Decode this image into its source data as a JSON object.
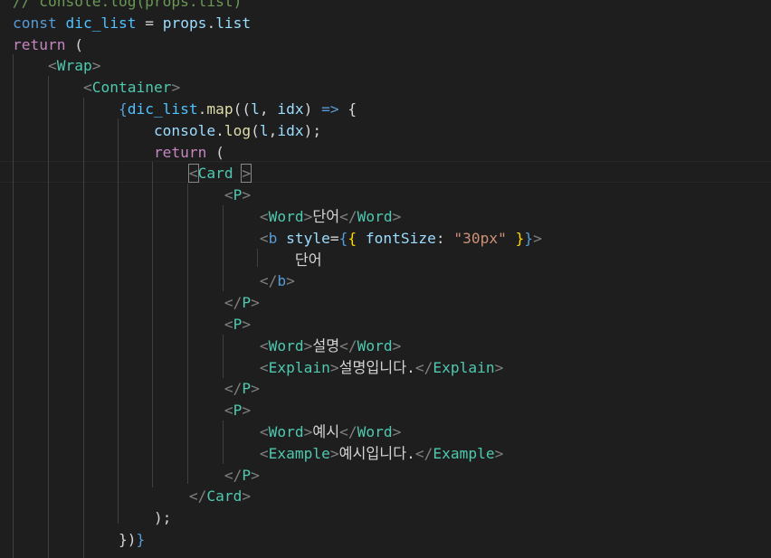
{
  "editor": {
    "lines": [
      [
        {
          "t": "// console.log(props.list)",
          "c": "comment"
        }
      ],
      [
        {
          "t": "const ",
          "c": "kw"
        },
        {
          "t": "dic_list",
          "c": "const"
        },
        {
          "t": " = ",
          "c": "op"
        },
        {
          "t": "props",
          "c": "var"
        },
        {
          "t": ".",
          "c": "op"
        },
        {
          "t": "list",
          "c": "var"
        }
      ],
      [
        {
          "t": "return",
          "c": "ctrl"
        },
        {
          "t": " (",
          "c": "op"
        }
      ],
      [
        {
          "t": "    ",
          "c": "text"
        },
        {
          "t": "<",
          "c": "punc"
        },
        {
          "t": "Wrap",
          "c": "tag"
        },
        {
          "t": ">",
          "c": "punc"
        }
      ],
      [
        {
          "t": "        ",
          "c": "text"
        },
        {
          "t": "<",
          "c": "punc"
        },
        {
          "t": "Container",
          "c": "tag"
        },
        {
          "t": ">",
          "c": "punc"
        }
      ],
      [
        {
          "t": "            ",
          "c": "text"
        },
        {
          "t": "{",
          "c": "brace"
        },
        {
          "t": "dic_list",
          "c": "const"
        },
        {
          "t": ".",
          "c": "op"
        },
        {
          "t": "map",
          "c": "fn"
        },
        {
          "t": "((",
          "c": "op"
        },
        {
          "t": "l",
          "c": "var"
        },
        {
          "t": ", ",
          "c": "op"
        },
        {
          "t": "idx",
          "c": "var"
        },
        {
          "t": ") ",
          "c": "op"
        },
        {
          "t": "=>",
          "c": "kw"
        },
        {
          "t": " {",
          "c": "op"
        }
      ],
      [
        {
          "t": "                ",
          "c": "text"
        },
        {
          "t": "console",
          "c": "var"
        },
        {
          "t": ".",
          "c": "op"
        },
        {
          "t": "log",
          "c": "fn"
        },
        {
          "t": "(",
          "c": "op"
        },
        {
          "t": "l",
          "c": "var"
        },
        {
          "t": ",",
          "c": "op"
        },
        {
          "t": "idx",
          "c": "var"
        },
        {
          "t": ");",
          "c": "op"
        }
      ],
      [
        {
          "t": "                ",
          "c": "text"
        },
        {
          "t": "return",
          "c": "ctrl"
        },
        {
          "t": " (",
          "c": "op"
        }
      ],
      [
        {
          "t": "                    ",
          "c": "text"
        },
        {
          "t": "<",
          "c": "punc",
          "box": true
        },
        {
          "t": "Card",
          "c": "tag"
        },
        {
          "t": " ",
          "c": "text"
        },
        {
          "t": ">",
          "c": "punc",
          "box": true
        }
      ],
      [
        {
          "t": "                        ",
          "c": "text"
        },
        {
          "t": "<",
          "c": "punc"
        },
        {
          "t": "P",
          "c": "tag"
        },
        {
          "t": ">",
          "c": "punc"
        }
      ],
      [
        {
          "t": "                            ",
          "c": "text"
        },
        {
          "t": "<",
          "c": "punc"
        },
        {
          "t": "Word",
          "c": "tag"
        },
        {
          "t": ">",
          "c": "punc"
        },
        {
          "t": "단어",
          "c": "text"
        },
        {
          "t": "</",
          "c": "punc"
        },
        {
          "t": "Word",
          "c": "tag"
        },
        {
          "t": ">",
          "c": "punc"
        }
      ],
      [
        {
          "t": "                            ",
          "c": "text"
        },
        {
          "t": "<",
          "c": "punc"
        },
        {
          "t": "b",
          "c": "kw"
        },
        {
          "t": " ",
          "c": "text"
        },
        {
          "t": "style",
          "c": "var"
        },
        {
          "t": "=",
          "c": "op"
        },
        {
          "t": "{",
          "c": "brace"
        },
        {
          "t": "{ ",
          "c": "gold"
        },
        {
          "t": "fontSize",
          "c": "var"
        },
        {
          "t": ": ",
          "c": "op"
        },
        {
          "t": "\"30px\"",
          "c": "str"
        },
        {
          "t": " }",
          "c": "gold"
        },
        {
          "t": "}",
          "c": "brace"
        },
        {
          "t": ">",
          "c": "punc"
        }
      ],
      [
        {
          "t": "                                ",
          "c": "text"
        },
        {
          "t": "단어",
          "c": "text"
        }
      ],
      [
        {
          "t": "                            ",
          "c": "text"
        },
        {
          "t": "</",
          "c": "punc"
        },
        {
          "t": "b",
          "c": "kw"
        },
        {
          "t": ">",
          "c": "punc"
        }
      ],
      [
        {
          "t": "                        ",
          "c": "text"
        },
        {
          "t": "</",
          "c": "punc"
        },
        {
          "t": "P",
          "c": "tag"
        },
        {
          "t": ">",
          "c": "punc"
        }
      ],
      [
        {
          "t": "                        ",
          "c": "text"
        },
        {
          "t": "<",
          "c": "punc"
        },
        {
          "t": "P",
          "c": "tag"
        },
        {
          "t": ">",
          "c": "punc"
        }
      ],
      [
        {
          "t": "                            ",
          "c": "text"
        },
        {
          "t": "<",
          "c": "punc"
        },
        {
          "t": "Word",
          "c": "tag"
        },
        {
          "t": ">",
          "c": "punc"
        },
        {
          "t": "설명",
          "c": "text"
        },
        {
          "t": "</",
          "c": "punc"
        },
        {
          "t": "Word",
          "c": "tag"
        },
        {
          "t": ">",
          "c": "punc"
        }
      ],
      [
        {
          "t": "                            ",
          "c": "text"
        },
        {
          "t": "<",
          "c": "punc"
        },
        {
          "t": "Explain",
          "c": "tag"
        },
        {
          "t": ">",
          "c": "punc"
        },
        {
          "t": "설명입니다.",
          "c": "text"
        },
        {
          "t": "</",
          "c": "punc"
        },
        {
          "t": "Explain",
          "c": "tag"
        },
        {
          "t": ">",
          "c": "punc"
        }
      ],
      [
        {
          "t": "                        ",
          "c": "text"
        },
        {
          "t": "</",
          "c": "punc"
        },
        {
          "t": "P",
          "c": "tag"
        },
        {
          "t": ">",
          "c": "punc"
        }
      ],
      [
        {
          "t": "                        ",
          "c": "text"
        },
        {
          "t": "<",
          "c": "punc"
        },
        {
          "t": "P",
          "c": "tag"
        },
        {
          "t": ">",
          "c": "punc"
        }
      ],
      [
        {
          "t": "                            ",
          "c": "text"
        },
        {
          "t": "<",
          "c": "punc"
        },
        {
          "t": "Word",
          "c": "tag"
        },
        {
          "t": ">",
          "c": "punc"
        },
        {
          "t": "예시",
          "c": "text"
        },
        {
          "t": "</",
          "c": "punc"
        },
        {
          "t": "Word",
          "c": "tag"
        },
        {
          "t": ">",
          "c": "punc"
        }
      ],
      [
        {
          "t": "                            ",
          "c": "text"
        },
        {
          "t": "<",
          "c": "punc"
        },
        {
          "t": "Example",
          "c": "tag"
        },
        {
          "t": ">",
          "c": "punc"
        },
        {
          "t": "예시입니다.",
          "c": "text"
        },
        {
          "t": "</",
          "c": "punc"
        },
        {
          "t": "Example",
          "c": "tag"
        },
        {
          "t": ">",
          "c": "punc"
        }
      ],
      [
        {
          "t": "                        ",
          "c": "text"
        },
        {
          "t": "</",
          "c": "punc"
        },
        {
          "t": "P",
          "c": "tag"
        },
        {
          "t": ">",
          "c": "punc"
        }
      ],
      [
        {
          "t": "                    ",
          "c": "text"
        },
        {
          "t": "</",
          "c": "punc"
        },
        {
          "t": "Card",
          "c": "tag"
        },
        {
          "t": ">",
          "c": "punc"
        }
      ],
      [
        {
          "t": "                ",
          "c": "text"
        },
        {
          "t": ");",
          "c": "op"
        }
      ],
      [
        {
          "t": "            ",
          "c": "text"
        },
        {
          "t": "})",
          "c": "op"
        },
        {
          "t": "}",
          "c": "brace"
        }
      ]
    ]
  },
  "colors": {
    "background": "#1e1e1e",
    "keyword": "#569cd6",
    "control": "#c586c0",
    "variable": "#9cdcfe",
    "constant": "#4fc1ff",
    "function": "#dcdcaa",
    "tag": "#4ec9b0",
    "punctuation": "#808080",
    "string": "#ce9178",
    "text": "#d4d4d4"
  }
}
